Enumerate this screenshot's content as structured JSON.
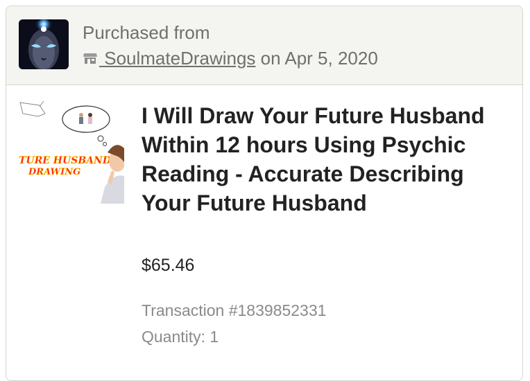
{
  "header": {
    "purchased_label": "Purchased from",
    "shop_name": " SoulmateDrawings",
    "date_text": " on Apr 5, 2020"
  },
  "listing": {
    "title": "I Will Draw Your Future Husband Within 12 hours Using Psychic Reading - Accurate Describing Your Future Husband",
    "price": "$65.46",
    "transaction": "Transaction #1839852331",
    "quantity": "Quantity: 1",
    "thumbnail_text_line1": "TURE HUSBAND",
    "thumbnail_text_line2": "DRAWING"
  },
  "icons": {
    "avatar": "mystic-face-avatar",
    "shop": "shop-icon"
  }
}
